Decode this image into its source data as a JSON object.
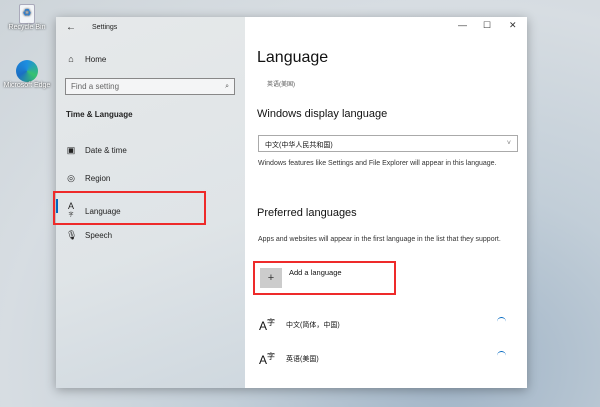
{
  "desktop": {
    "icons": [
      {
        "label": "Recycle Bin"
      },
      {
        "label": "Microsoft Edge"
      }
    ]
  },
  "window": {
    "title": "Settings",
    "controls": {
      "minimize": "—",
      "maximize": "☐",
      "close": "✕"
    }
  },
  "sidebar": {
    "home": "Home",
    "search_placeholder": "Find a setting",
    "section": "Time & Language",
    "items": [
      {
        "label": "Date & time"
      },
      {
        "label": "Region"
      },
      {
        "label": "Language"
      },
      {
        "label": "Speech"
      }
    ]
  },
  "main": {
    "title": "Language",
    "subtitle": "英语(美国)",
    "display_heading": "Windows display language",
    "display_value": "中文(中华人民共和国)",
    "display_note": "Windows features like Settings and File Explorer will appear in this language.",
    "preferred_heading": "Preferred languages",
    "preferred_note": "Apps and websites will appear in the first language in the list that they support.",
    "add_label": "Add a language",
    "languages": [
      {
        "name": "中文(简体，中国)"
      },
      {
        "name": "英语(美国)"
      }
    ]
  },
  "accent": "#0067c0",
  "highlight": "#ee2a2a"
}
